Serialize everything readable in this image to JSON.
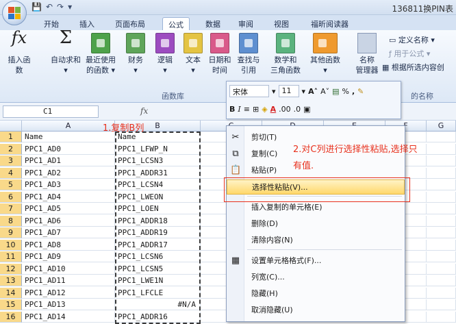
{
  "window": {
    "title": "136811换PIN表"
  },
  "ribbon_tabs": [
    "开始",
    "插入",
    "页面布局",
    "公式",
    "数据",
    "审阅",
    "视图",
    "福昕阅读器"
  ],
  "active_tab": "公式",
  "ribbon": {
    "buttons": [
      {
        "label1": "插入函数",
        "label2": "",
        "icon": "fx-icon"
      },
      {
        "label1": "自动求和",
        "label2": "",
        "icon": "sigma-icon"
      },
      {
        "label1": "最近使用",
        "label2": "的函数",
        "icon": "book-icon"
      },
      {
        "label1": "财务",
        "label2": "",
        "icon": "book-icon"
      },
      {
        "label1": "逻辑",
        "label2": "",
        "icon": "book-icon"
      },
      {
        "label1": "文本",
        "label2": "",
        "icon": "book-icon"
      },
      {
        "label1": "日期和",
        "label2": "时间",
        "icon": "book-icon"
      },
      {
        "label1": "查找与",
        "label2": "引用",
        "icon": "book-icon"
      },
      {
        "label1": "数学和",
        "label2": "三角函数",
        "icon": "book-icon"
      },
      {
        "label1": "其他函数",
        "label2": "",
        "icon": "book-icon"
      },
      {
        "label1": "名称",
        "label2": "管理器",
        "icon": "name-manager-icon"
      }
    ],
    "group_label": "函数库",
    "right_items": [
      "定义名称",
      "用于公式",
      "根据所选内容创",
      "的名称"
    ]
  },
  "minibar": {
    "font": "宋体",
    "size": "11",
    "bold": "B",
    "italic": "I"
  },
  "formula_bar": {
    "cell_ref": "C1",
    "fx": "fx"
  },
  "columns": [
    "A",
    "B",
    "C",
    "D",
    "E",
    "F",
    "G"
  ],
  "rows": [
    {
      "n": "1",
      "a": "Name",
      "b": "Name"
    },
    {
      "n": "2",
      "a": "PPC1_AD0",
      "b": "PPC1_LFWP_N"
    },
    {
      "n": "3",
      "a": "PPC1_AD1",
      "b": "PPC1_LCSN3"
    },
    {
      "n": "4",
      "a": "PPC1_AD2",
      "b": "PPC1_ADDR31"
    },
    {
      "n": "5",
      "a": "PPC1_AD3",
      "b": "PPC1_LCSN4"
    },
    {
      "n": "6",
      "a": "PPC1_AD4",
      "b": "PPC1_LWEON"
    },
    {
      "n": "7",
      "a": "PPC1_AD5",
      "b": "PPC1_LOEN"
    },
    {
      "n": "8",
      "a": "PPC1_AD6",
      "b": "PPC1_ADDR18"
    },
    {
      "n": "9",
      "a": "PPC1_AD7",
      "b": "PPC1_ADDR19"
    },
    {
      "n": "10",
      "a": "PPC1_AD8",
      "b": "PPC1_ADDR17"
    },
    {
      "n": "11",
      "a": "PPC1_AD9",
      "b": "PPC1_LCSN6"
    },
    {
      "n": "12",
      "a": "PPC1_AD10",
      "b": "PPC1_LCSN5"
    },
    {
      "n": "13",
      "a": "PPC1_AD11",
      "b": "PPC1_LWE1N"
    },
    {
      "n": "14",
      "a": "PPC1_AD12",
      "b": "PPC1_LFCLE"
    },
    {
      "n": "15",
      "a": "PPC1_AD13",
      "b": "#N/A"
    },
    {
      "n": "16",
      "a": "PPC1_AD14",
      "b": "PPC1_ADDR16"
    }
  ],
  "annotations": {
    "step1": "1.复制B列",
    "step2": "2.对C列进行选择性粘贴,选择只有值."
  },
  "context_menu": [
    {
      "label": "剪切(T)",
      "icon": "scissors-icon"
    },
    {
      "label": "复制(C)",
      "icon": "copy-icon"
    },
    {
      "label": "粘贴(P)",
      "icon": "paste-icon"
    },
    {
      "label": "选择性粘贴(V)...",
      "icon": "",
      "highlight": true
    },
    {
      "label": "插入复制的单元格(E)",
      "icon": ""
    },
    {
      "label": "删除(D)",
      "icon": ""
    },
    {
      "label": "清除内容(N)",
      "icon": ""
    },
    {
      "label": "设置单元格格式(F)...",
      "icon": "format-cells-icon"
    },
    {
      "label": "列宽(C)...",
      "icon": ""
    },
    {
      "label": "隐藏(H)",
      "icon": ""
    },
    {
      "label": "取消隐藏(U)",
      "icon": ""
    }
  ]
}
